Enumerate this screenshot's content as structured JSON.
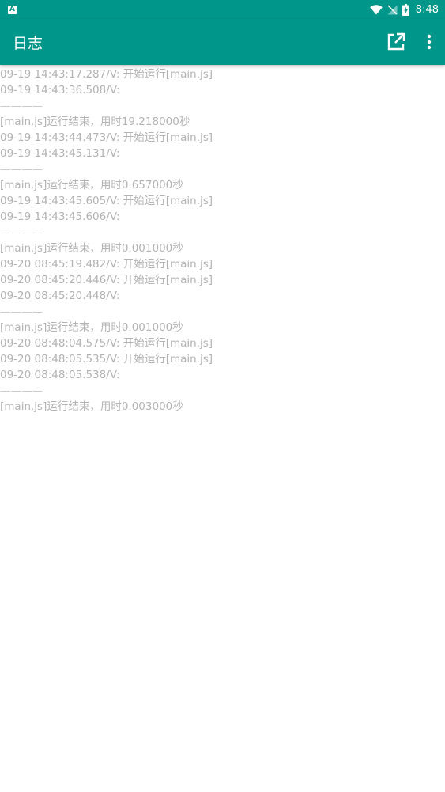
{
  "status_bar": {
    "left_icon": "A",
    "icons": [
      "wifi-icon",
      "no-signal-icon",
      "battery-charging-icon"
    ],
    "time": "8:48"
  },
  "app_bar": {
    "title": "日志",
    "actions": [
      "open-external-icon",
      "more-vert-icon"
    ]
  },
  "log": {
    "lines": [
      "09-19 14:43:17.287/V: 开始运行[main.js]",
      "09-19 14:43:36.508/V:",
      "————",
      "[main.js]运行结束，用时19.218000秒",
      "09-19 14:43:44.473/V: 开始运行[main.js]",
      "09-19 14:43:45.131/V:",
      "————",
      "[main.js]运行结束，用时0.657000秒",
      "09-19 14:43:45.605/V: 开始运行[main.js]",
      "09-19 14:43:45.606/V:",
      "————",
      "[main.js]运行结束，用时0.001000秒",
      "09-20 08:45:19.482/V: 开始运行[main.js]",
      "09-20 08:45:20.446/V: 开始运行[main.js]",
      "09-20 08:45:20.448/V:",
      "————",
      "[main.js]运行结束，用时0.001000秒",
      "09-20 08:48:04.575/V: 开始运行[main.js]",
      "09-20 08:48:05.535/V: 开始运行[main.js]",
      "09-20 08:48:05.538/V:",
      "————",
      "[main.js]运行结束，用时0.003000秒"
    ]
  },
  "colors": {
    "primary": "#00968a",
    "log_text": "#b3b3b3"
  }
}
